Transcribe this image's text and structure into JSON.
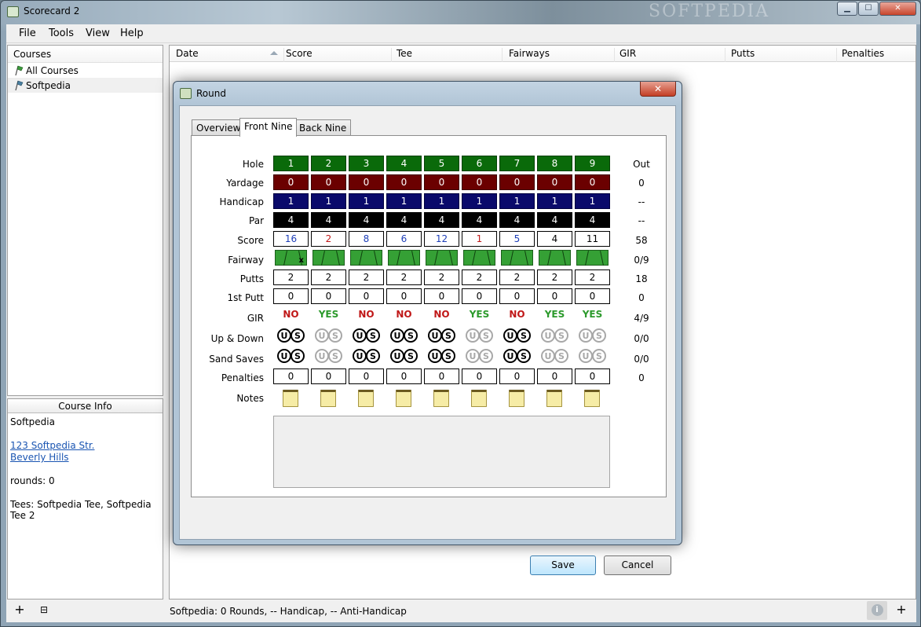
{
  "app": {
    "title": "Scorecard 2",
    "watermark": "SOFTPEDIA"
  },
  "menu": [
    "File",
    "Tools",
    "View",
    "Help"
  ],
  "courses": {
    "header": "Courses",
    "items": [
      "All Courses",
      "Softpedia"
    ]
  },
  "course_info": {
    "header": "Course Info",
    "name": "Softpedia",
    "address1": "123 Softpedia Str.",
    "address2": "Beverly Hills",
    "rounds": "rounds: 0",
    "tees": "Tees: Softpedia Tee, Softpedia Tee 2"
  },
  "rounds_table": {
    "columns": [
      "Date",
      "Score",
      "Tee",
      "Fairways",
      "GIR",
      "Putts",
      "Penalties"
    ]
  },
  "status": {
    "text": "Softpedia: 0 Rounds, -- Handicap, -- Anti-Handicap"
  },
  "dialog": {
    "title": "Round",
    "tabs": [
      "Overview",
      "Front Nine",
      "Back Nine"
    ],
    "active_tab": "Front Nine",
    "row_labels": [
      "Hole",
      "Yardage",
      "Handicap",
      "Par",
      "Score",
      "Fairway",
      "Putts",
      "1st Putt",
      "GIR",
      "Up & Down",
      "Sand Saves",
      "Penalties",
      "Notes"
    ],
    "holes": [
      "1",
      "2",
      "3",
      "4",
      "5",
      "6",
      "7",
      "8",
      "9"
    ],
    "yardage": [
      "0",
      "0",
      "0",
      "0",
      "0",
      "0",
      "0",
      "0",
      "0"
    ],
    "handicap": [
      "1",
      "1",
      "1",
      "1",
      "1",
      "1",
      "1",
      "1",
      "1"
    ],
    "par": [
      "4",
      "4",
      "4",
      "4",
      "4",
      "4",
      "4",
      "4",
      "4"
    ],
    "score": [
      "16",
      "2",
      "8",
      "6",
      "12",
      "1",
      "5",
      "4",
      "11"
    ],
    "score_colors": [
      "#1e3fb8",
      "#c01818",
      "#1e3fb8",
      "#1e3fb8",
      "#1e3fb8",
      "#c01818",
      "#1e3fb8",
      "#000000",
      "#000000"
    ],
    "fairway_miss_mark": "x",
    "putts": [
      "2",
      "2",
      "2",
      "2",
      "2",
      "2",
      "2",
      "2",
      "2"
    ],
    "first_putt": [
      "0",
      "0",
      "0",
      "0",
      "0",
      "0",
      "0",
      "0",
      "0"
    ],
    "gir": [
      "NO",
      "YES",
      "NO",
      "NO",
      "NO",
      "YES",
      "NO",
      "YES",
      "YES"
    ],
    "up_down_active": [
      true,
      false,
      true,
      true,
      true,
      false,
      true,
      false,
      false
    ],
    "sand_saves_active": [
      true,
      false,
      true,
      true,
      true,
      false,
      true,
      false,
      false
    ],
    "us_letters": [
      "U",
      "S"
    ],
    "penalties": [
      "0",
      "0",
      "0",
      "0",
      "0",
      "0",
      "0",
      "0",
      "0"
    ],
    "totals": {
      "hole": "Out",
      "yardage": "0",
      "handicap": "--",
      "par": "--",
      "score": "58",
      "fairway": "0/9",
      "putts": "18",
      "first_putt": "0",
      "gir": "4/9",
      "up_down": "0/0",
      "sand_saves": "0/0",
      "penalties": "0"
    },
    "save_label": "Save",
    "cancel_label": "Cancel"
  }
}
